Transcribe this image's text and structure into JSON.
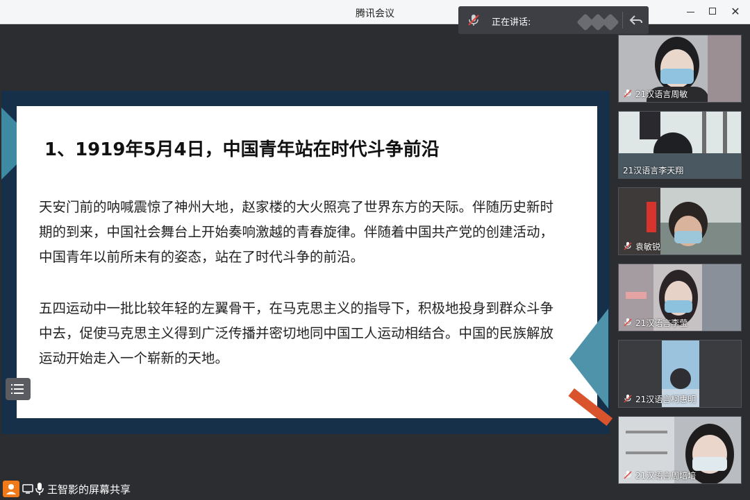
{
  "window": {
    "title": "腾讯会议",
    "controls": [
      "minimize",
      "maximize",
      "close"
    ]
  },
  "speaking": {
    "label": "正在讲话:"
  },
  "slide": {
    "title": "1、1919年5月4日，中国青年站在时代斗争前沿",
    "paragraphs": [
      "天安门前的呐喊震惊了神州大地，赵家楼的大火照亮了世界东方的天际。伴随历史新时期的到来，中国社会舞台上开始奏响激越的青春旋律。伴随着中国共产党的创建活动，中国青年以前所未有的姿态，站在了时代斗争的前沿。",
      "五四运动中一批比较年轻的左翼骨干，在马克思主义的指导下，积极地投身到群众斗争中去，促使马克思主义得到广泛传播并密切地同中国工人运动相结合。中国的民族解放运动开始走入一个崭新的天地。"
    ]
  },
  "share_bar": {
    "label": "王智影的屏幕共享"
  },
  "participants": [
    {
      "name": "21汉语言周敏",
      "muted": true
    },
    {
      "name": "21汉语言李天翔",
      "muted": false
    },
    {
      "name": "袁敏锐",
      "muted": true
    },
    {
      "name": "21汉语言李莹",
      "muted": true
    },
    {
      "name": "21汉语言柯惠明",
      "muted": true
    },
    {
      "name": "21汉语言周培培",
      "muted": true
    }
  ],
  "colors": {
    "slide_band": "#16304a",
    "accent_teal": "#3f8aa3",
    "accent_orange": "#d9532c",
    "share_icon": "#f07a19"
  }
}
